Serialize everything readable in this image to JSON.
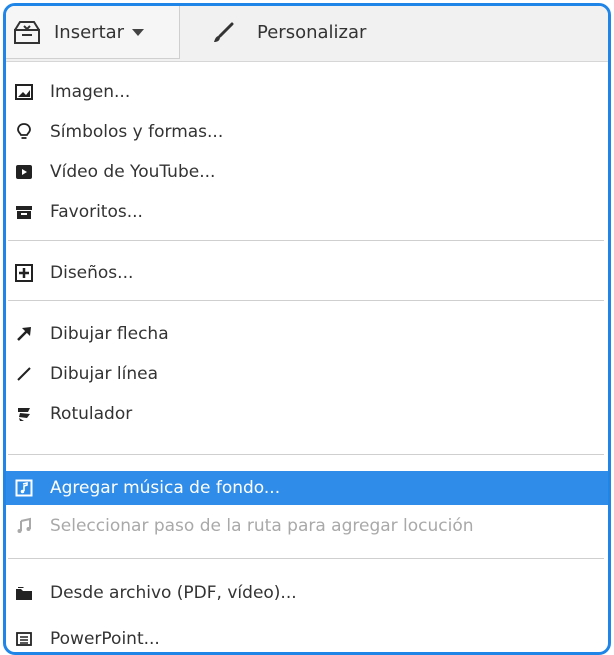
{
  "toolbar": {
    "insert_label": "Insertar",
    "personalize_label": "Personalizar"
  },
  "menu": {
    "items": [
      {
        "label": "Imagen...",
        "icon": "image-icon"
      },
      {
        "label": "Símbolos y formas...",
        "icon": "lightbulb-icon"
      },
      {
        "label": "Vídeo de YouTube...",
        "icon": "youtube-play-icon"
      },
      {
        "label": "Favoritos...",
        "icon": "archive-box-icon"
      },
      {
        "label": "Diseños...",
        "icon": "plus-square-icon"
      },
      {
        "label": "Dibujar flecha",
        "icon": "arrow-icon"
      },
      {
        "label": "Dibujar línea",
        "icon": "line-icon"
      },
      {
        "label": "Rotulador",
        "icon": "marker-icon"
      },
      {
        "label": "Agregar música de fondo...",
        "icon": "music-file-icon",
        "state": "highlighted"
      },
      {
        "label": "Seleccionar paso de la ruta para agregar locución",
        "icon": "music-note-icon",
        "state": "disabled"
      },
      {
        "label": "Desde archivo (PDF, vídeo)...",
        "icon": "folder-icon"
      },
      {
        "label": "PowerPoint...",
        "icon": "presentation-icon"
      }
    ]
  },
  "colors": {
    "frame_border": "#1f86e8",
    "highlight": "#2f8ce8",
    "disabled_text": "#a9a9a9"
  }
}
